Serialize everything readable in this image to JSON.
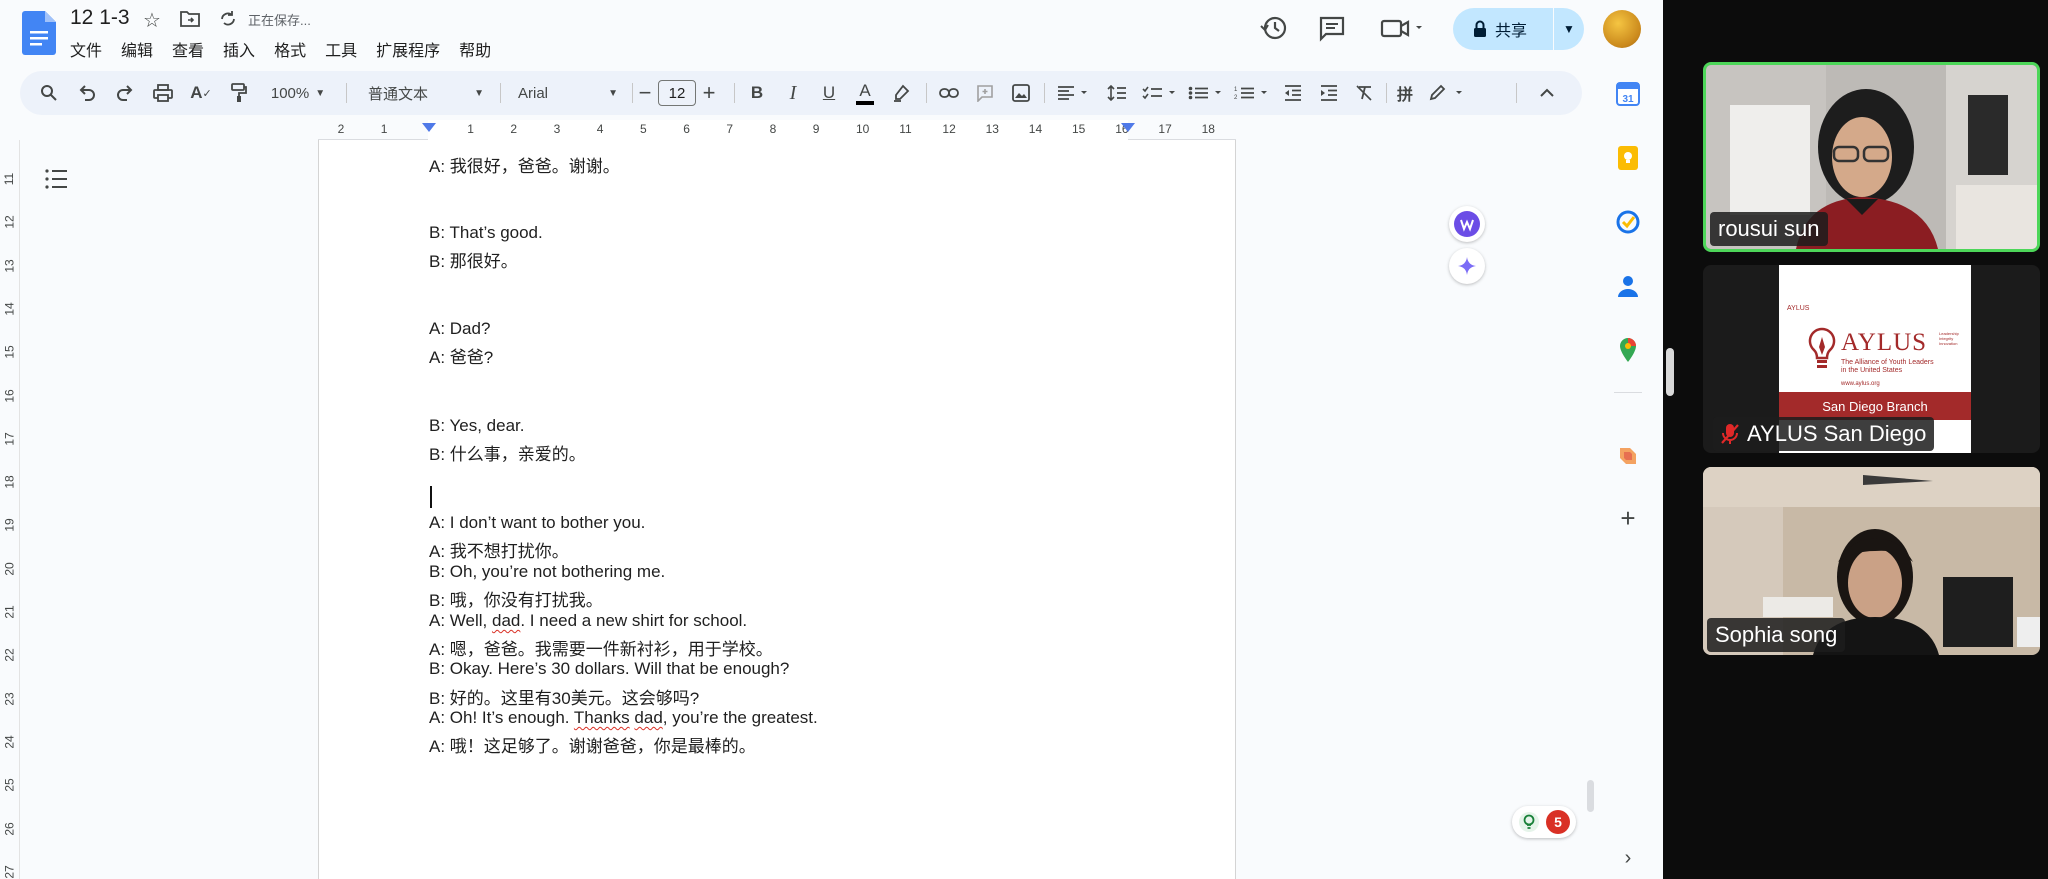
{
  "doc": {
    "title": "12 1-3",
    "saving_status": "正在保存...",
    "menu": [
      "文件",
      "编辑",
      "查看",
      "插入",
      "格式",
      "工具",
      "扩展程序",
      "帮助"
    ],
    "share_label": "共享",
    "toolbar": {
      "zoom": "100%",
      "style": "普通文本",
      "font": "Arial",
      "font_size": "12"
    },
    "ruler_numbers": [
      "2",
      "1",
      "1",
      "2",
      "3",
      "4",
      "5",
      "6",
      "7",
      "8",
      "9",
      "10",
      "11",
      "12",
      "13",
      "14",
      "15",
      "16",
      "17",
      "18"
    ],
    "vruler_numbers": [
      "11",
      "12",
      "13",
      "14",
      "15",
      "16",
      "17",
      "18",
      "19",
      "20",
      "21",
      "22",
      "23",
      "24",
      "25",
      "26",
      "27"
    ],
    "lines": [
      "A: 我很好，爸爸。谢谢。",
      "B: That’s good.",
      "B: 那很好。",
      "A: Dad?",
      "A: 爸爸?",
      "B: Yes, dear.",
      "B: 什么事，亲爱的。",
      "A: I don’t want to bother you.",
      "A: 我不想打扰你。",
      "B: Oh, you’re not bothering me.",
      "B: 哦，你没有打扰我。",
      "A: Well, dad. I need a new shirt for school.",
      "A: 嗯，爸爸。我需要一件新衬衫，用于学校。",
      "B: Okay. Here’s 30 dollars. Will that be enough?",
      "B: 好的。这里有30美元。这会够吗?",
      "A: Oh! It’s enough. Thanks dad, you’re the greatest.",
      "A: 哦！这足够了。谢谢爸爸，你是最棒的。"
    ],
    "badge_count": "5"
  },
  "zoom": {
    "participants": [
      {
        "name": "rousui sun"
      },
      {
        "name": "AYLUS San Diego"
      },
      {
        "name": "Sophia song"
      }
    ],
    "aylus_card": {
      "small_logo": "AYLUS",
      "big_logo": "AYLUS",
      "tagline": "The Alliance of Youth Leaders in the United States",
      "side_words": "Leadership Integrity Innovation",
      "url": "www.aylus.org",
      "branch": "San Diego Branch"
    }
  },
  "colors": {
    "share_bg": "#c2e7ff",
    "active_speaker": "#4dd659",
    "aylus_red": "#a32a2a"
  },
  "icons": [
    "google-docs-logo-icon",
    "star-icon",
    "move-to-folder-icon",
    "sync-icon",
    "history-icon",
    "comment-icon",
    "meet-camera-icon",
    "lock-icon",
    "search-icon",
    "undo-icon",
    "redo-icon",
    "print-icon",
    "spellcheck-icon",
    "paint-format-icon",
    "bold-icon",
    "italic-icon",
    "underline-icon",
    "text-color-icon",
    "highlight-icon",
    "link-icon",
    "add-comment-icon",
    "image-icon",
    "align-icon",
    "line-spacing-icon",
    "checklist-icon",
    "bullet-list-icon",
    "numbered-list-icon",
    "indent-decrease-icon",
    "indent-increase-icon",
    "clear-format-icon",
    "pinyin-icon",
    "editing-mode-icon",
    "collapse-icon",
    "outline-icon",
    "calendar-icon",
    "keep-icon",
    "tasks-icon",
    "contacts-icon",
    "maps-icon",
    "addon-icon",
    "plus-icon",
    "chevron-right-icon",
    "muted-mic-icon"
  ]
}
